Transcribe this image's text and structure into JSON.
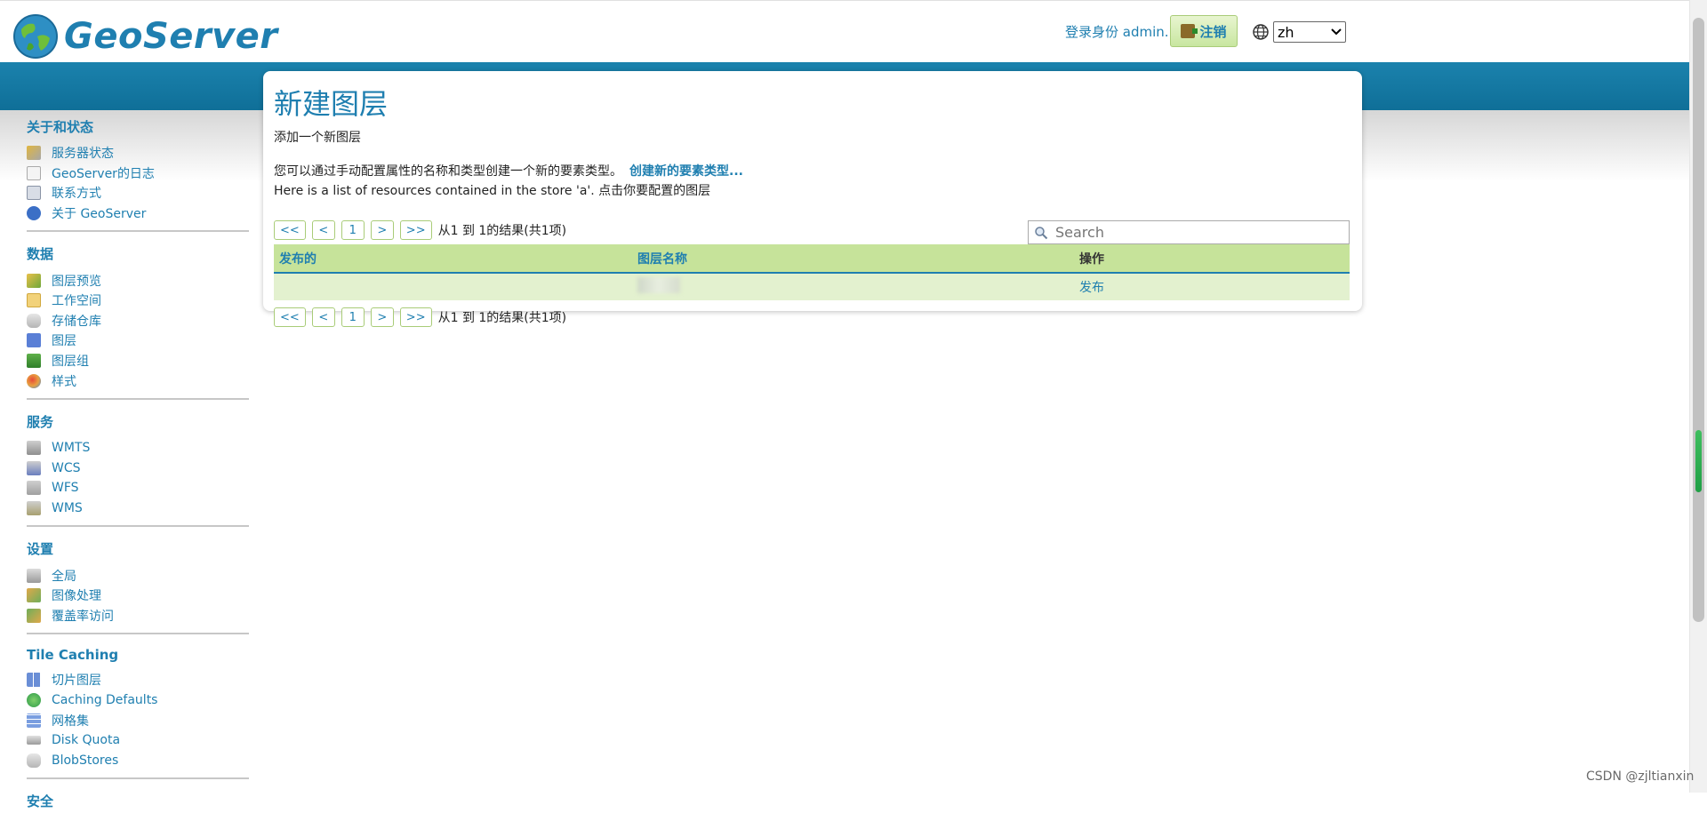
{
  "header": {
    "logo_text": "GeoServer",
    "login_text": "登录身份 admin.",
    "logout_label": "注销",
    "language_value": "zh"
  },
  "sidebar": {
    "sections": [
      {
        "title": "关于和状态",
        "items": [
          "服务器状态",
          "GeoServer的日志",
          "联系方式",
          "关于 GeoServer"
        ]
      },
      {
        "title": "数据",
        "items": [
          "图层预览",
          "工作空间",
          "存储仓库",
          "图层",
          "图层组",
          "样式"
        ]
      },
      {
        "title": "服务",
        "items": [
          "WMTS",
          "WCS",
          "WFS",
          "WMS"
        ]
      },
      {
        "title": "设置",
        "items": [
          "全局",
          "图像处理",
          "覆盖率访问"
        ]
      },
      {
        "title": "Tile Caching",
        "items": [
          "切片图层",
          "Caching Defaults",
          "网格集",
          "Disk Quota",
          "BlobStores"
        ]
      },
      {
        "title": "安全",
        "items": []
      }
    ]
  },
  "main": {
    "title": "新建图层",
    "subtitle": "添加一个新图层",
    "description": "您可以通过手动配置属性的名称和类型创建一个新的要素类型。",
    "create_link": "创建新的要素类型...",
    "store_text": "Here is a list of resources contained in the store 'a'. 点击你要配置的图层",
    "pager": {
      "first": "<<",
      "prev": "<",
      "page": "1",
      "next": ">",
      "last": ">>",
      "info": "从1 到 1的结果(共1项)"
    },
    "search_placeholder": "Search",
    "table": {
      "headers": [
        "发布的",
        "图层名称",
        "操作"
      ],
      "rows": [
        {
          "published": "",
          "name": "",
          "action": "发布"
        }
      ]
    }
  },
  "watermark": "CSDN @zjltianxin",
  "colors": {
    "accent": "#1f7fb0",
    "banner": "#1b82ad",
    "table_header": "#c6e39a",
    "table_row": "#e3f1cf"
  }
}
